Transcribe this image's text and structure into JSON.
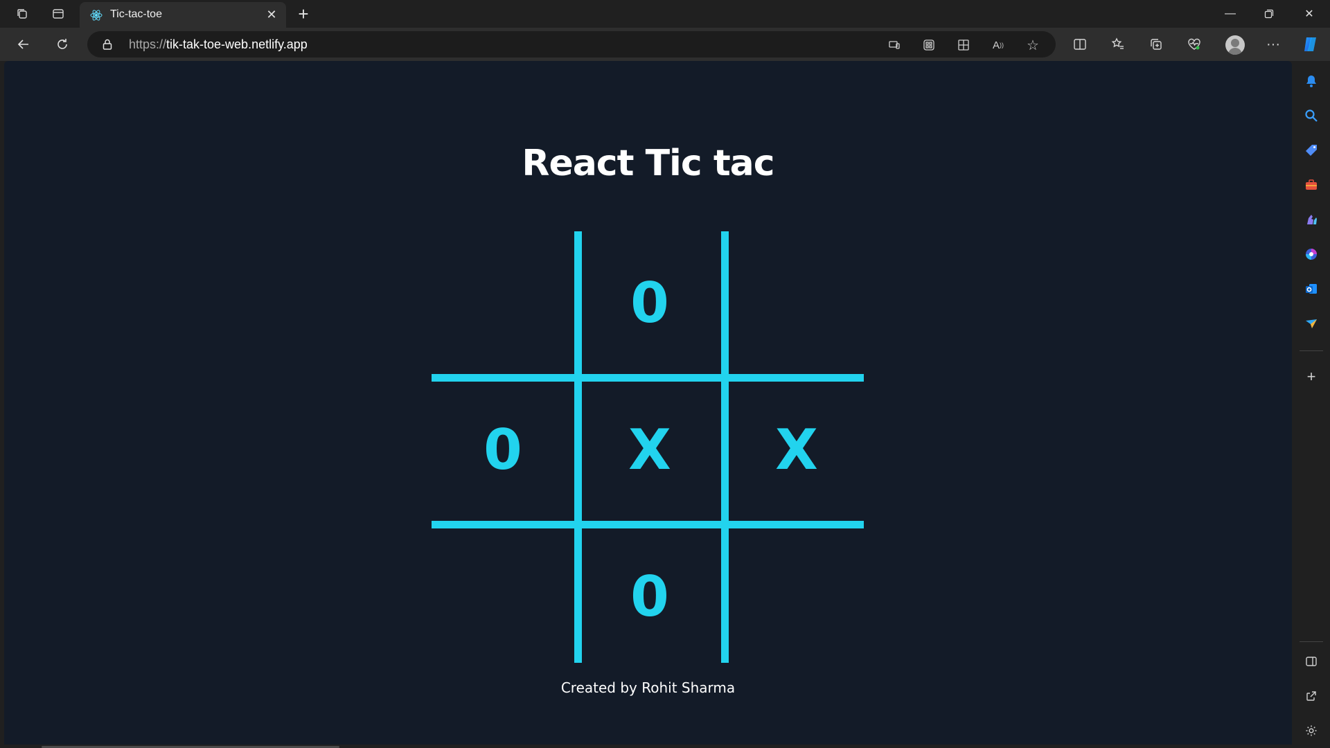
{
  "browser": {
    "tab": {
      "title": "Tic-tac-toe"
    },
    "address": {
      "scheme": "https://",
      "host": "tik-tak-toe-web.netlify.app"
    }
  },
  "page": {
    "title": "React Tic tac",
    "footer": "Created by Rohit Sharma"
  },
  "board": {
    "cells": [
      "",
      "0",
      "",
      "0",
      "X",
      "X",
      "",
      "0",
      ""
    ],
    "line_color": "#22d3ee",
    "mark_color": "#22d3ee"
  },
  "colors": {
    "page_background": "#131b28",
    "browser_chrome": "#202020",
    "accent": "#22d3ee"
  },
  "icons": {
    "titlebar": [
      "workspaces-icon",
      "vertical-tabs-icon"
    ],
    "toolbar": [
      "back-arrow-icon",
      "refresh-icon",
      "lock-icon"
    ],
    "address_actions": [
      "device-cast-icon",
      "app-available-icon",
      "extensions-icon",
      "read-aloud-icon",
      "favorite-star-icon"
    ],
    "toolbar_right": [
      "split-screen-icon",
      "favorites-icon",
      "collections-icon",
      "browser-essentials-icon",
      "profile-avatar",
      "more-options-icon",
      "copilot-icon"
    ],
    "sidebar": [
      "notifications-icon",
      "search-icon",
      "shopping-icon",
      "tools-icon",
      "games-icon",
      "microsoft-365-icon",
      "outlook-icon",
      "drop-icon",
      "add-icon",
      "hide-sidebar-icon",
      "open-external-icon",
      "settings-icon"
    ]
  }
}
